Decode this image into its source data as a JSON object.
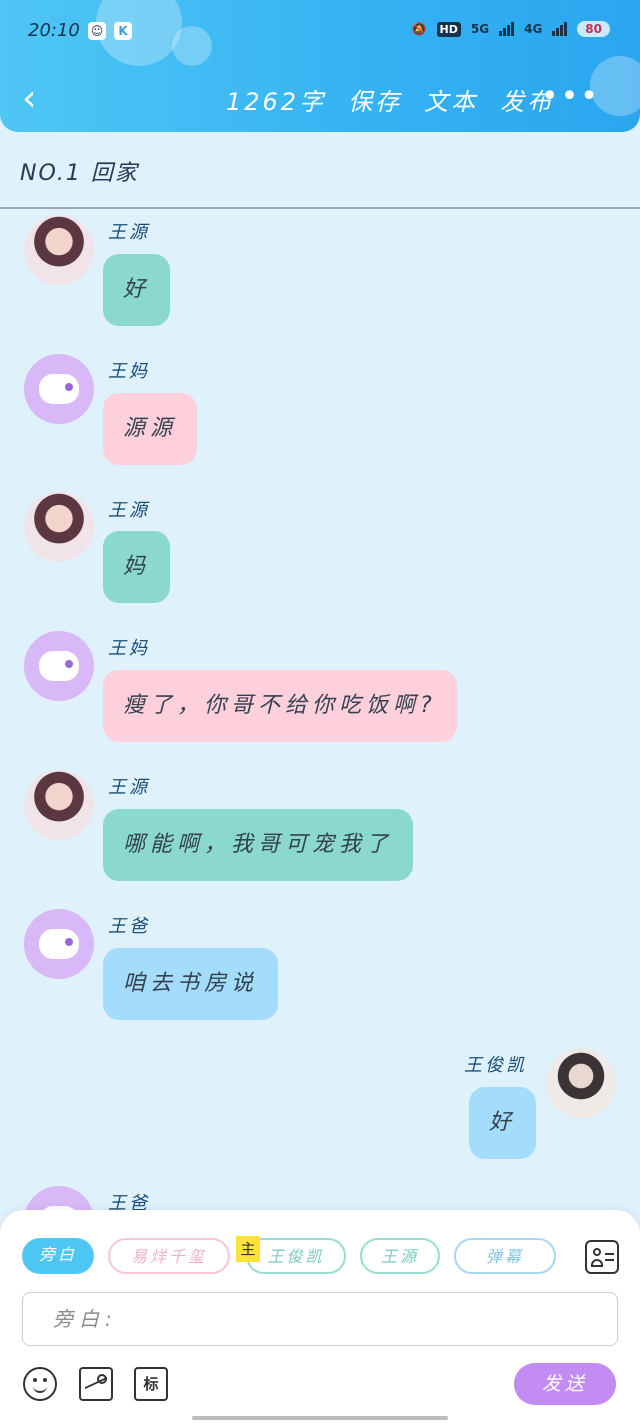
{
  "status_bar": {
    "time": "20:10",
    "network_1": "5G",
    "network_2": "4G",
    "hd_label": "HD",
    "battery": "80"
  },
  "header": {
    "word_count": "1262字",
    "save": "保存",
    "text": "文本",
    "publish": "发布",
    "more": "•••",
    "back": "‹"
  },
  "chapter_title": "NO.1 回家",
  "messages": [
    {
      "sender": "王源",
      "text": "好",
      "color": "#8ad9cc",
      "side": "left"
    },
    {
      "sender": "王妈",
      "text": "源源",
      "color": "#fdd0dc",
      "side": "left"
    },
    {
      "sender": "王源",
      "text": "妈",
      "color": "#8ad9cc",
      "side": "left"
    },
    {
      "sender": "王妈",
      "text": "瘦了，你哥不给你吃饭啊?",
      "color": "#fdd0dc",
      "side": "left"
    },
    {
      "sender": "王源",
      "text": "哪能啊，我哥可宠我了",
      "color": "#8ad9cc",
      "side": "left"
    },
    {
      "sender": "王爸",
      "text": "咱去书房说",
      "color": "#a4dcfb",
      "side": "left"
    },
    {
      "sender": "王俊凯",
      "text": "好",
      "color": "#a4dcfb",
      "side": "right"
    },
    {
      "sender": "王爸",
      "text": "",
      "color": "#a4dcfb",
      "side": "left"
    }
  ],
  "roles": {
    "narration": "旁白",
    "r1": "易烊千玺",
    "main_badge": "主",
    "r2": "王俊凯",
    "r3": "王源",
    "r4": "弹幕"
  },
  "input": {
    "placeholder": "旁白:"
  },
  "toolbar": {
    "tag_label": "标",
    "send": "发送"
  },
  "icons": [
    "back-icon",
    "more-icon",
    "contact-card-icon",
    "emoji-icon",
    "image-icon",
    "tag-icon"
  ]
}
